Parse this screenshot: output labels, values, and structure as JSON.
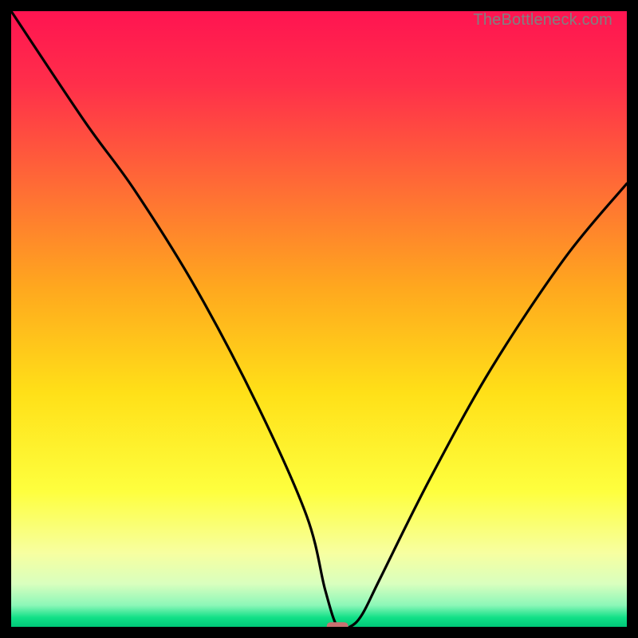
{
  "watermark": "TheBottleneck.com",
  "chart_data": {
    "type": "line",
    "title": "",
    "xlabel": "",
    "ylabel": "",
    "xlim": [
      0,
      100
    ],
    "ylim": [
      0,
      100
    ],
    "grid": false,
    "legend": false,
    "series": [
      {
        "name": "bottleneck-curve",
        "x": [
          0,
          12,
          20,
          30,
          40,
          48,
          51,
          53,
          55,
          57,
          60,
          68,
          78,
          90,
          100
        ],
        "values": [
          100,
          82,
          71,
          55,
          36,
          18,
          6,
          0,
          0,
          2,
          8,
          24,
          42,
          60,
          72
        ]
      }
    ],
    "marker": {
      "name": "optimal-point",
      "x": 53,
      "y": 0,
      "width": 3.5,
      "height": 1.5,
      "color": "#c97171"
    },
    "background_gradient": {
      "stops": [
        {
          "offset": 0.0,
          "color": "#ff1451"
        },
        {
          "offset": 0.12,
          "color": "#ff2f4a"
        },
        {
          "offset": 0.28,
          "color": "#ff6a36"
        },
        {
          "offset": 0.45,
          "color": "#ffa81e"
        },
        {
          "offset": 0.62,
          "color": "#ffe018"
        },
        {
          "offset": 0.78,
          "color": "#feff3e"
        },
        {
          "offset": 0.88,
          "color": "#f7ffa0"
        },
        {
          "offset": 0.93,
          "color": "#d9ffbe"
        },
        {
          "offset": 0.965,
          "color": "#8cf7b8"
        },
        {
          "offset": 0.985,
          "color": "#11e087"
        },
        {
          "offset": 1.0,
          "color": "#00c877"
        }
      ]
    }
  }
}
